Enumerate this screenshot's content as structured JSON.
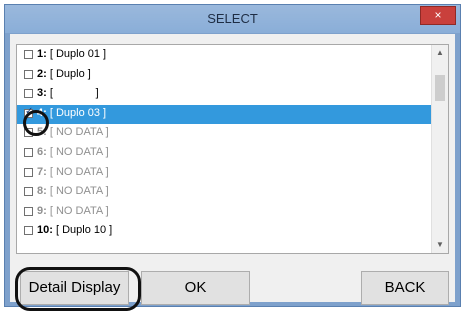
{
  "window": {
    "title": "SELECT",
    "close_glyph": "×"
  },
  "list": {
    "items": [
      {
        "num": "1:",
        "label": "[ Duplo 01 ]",
        "checked": false,
        "selected": false,
        "dim": false
      },
      {
        "num": "2:",
        "label": "[ Duplo ]",
        "checked": false,
        "selected": false,
        "dim": false
      },
      {
        "num": "3:",
        "label": "[              ]",
        "checked": false,
        "selected": false,
        "dim": false
      },
      {
        "num": "4:",
        "label": "[ Duplo 03 ]",
        "checked": true,
        "selected": true,
        "dim": false
      },
      {
        "num": "5:",
        "label": "[ NO DATA ]",
        "checked": false,
        "selected": false,
        "dim": true
      },
      {
        "num": "6:",
        "label": "[ NO DATA ]",
        "checked": false,
        "selected": false,
        "dim": true
      },
      {
        "num": "7:",
        "label": "[ NO DATA ]",
        "checked": false,
        "selected": false,
        "dim": true
      },
      {
        "num": "8:",
        "label": "[ NO DATA ]",
        "checked": false,
        "selected": false,
        "dim": true
      },
      {
        "num": "9:",
        "label": "[ NO DATA ]",
        "checked": false,
        "selected": false,
        "dim": true
      },
      {
        "num": "10:",
        "label": "[ Duplo 10 ]",
        "checked": false,
        "selected": false,
        "dim": false
      }
    ],
    "scroll_up_icon": "chevron-up-icon",
    "scroll_down_icon": "chevron-down-icon"
  },
  "buttons": {
    "detail_display": "Detail Display",
    "ok": "OK",
    "back": "BACK"
  },
  "colors": {
    "selection": "#3399dd",
    "titlebar": "#8aaed8",
    "close": "#c9403c"
  }
}
